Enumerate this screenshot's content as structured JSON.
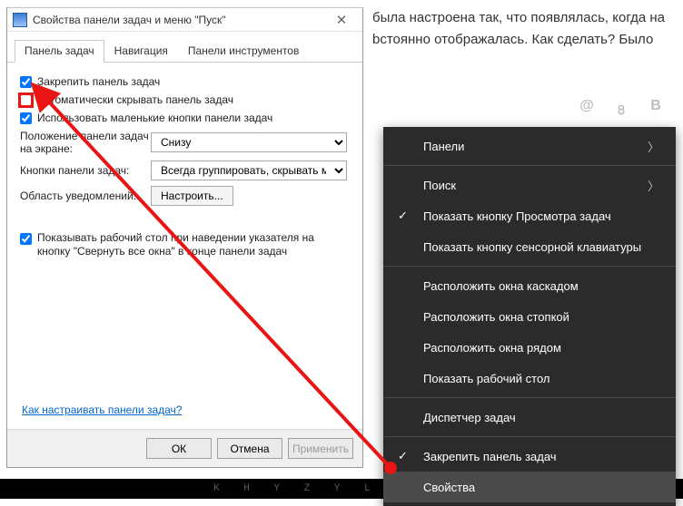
{
  "bg_text": "была настроена так, что появлялась, когда на bстоянно отображалась. Как сделать? Было",
  "icons": {
    "at": "@",
    "ok": "৪",
    "vk": "В"
  },
  "dialog": {
    "title": "Свойства панели задач и меню \"Пуск\"",
    "tabs": [
      "Панель задач",
      "Навигация",
      "Панели инструментов"
    ],
    "checkbox": {
      "lock": "Закрепить панель задач",
      "autohide": "Автоматически скрывать панель задач",
      "small": "Использовать маленькие кнопки панели задач"
    },
    "position": {
      "label": "Положение панели задач на экране:",
      "value": "Снизу"
    },
    "buttons_grouping": {
      "label": "Кнопки панели задач:",
      "value": "Всегда группировать, скрывать метки"
    },
    "notif": {
      "label": "Область уведомлений:",
      "button": "Настроить..."
    },
    "peek": "Показывать рабочий стол при наведении указателя на кнопку \"Свернуть все окна\" в конце панели задач",
    "help": "Как настраивать панели задач?",
    "ok": "ОК",
    "cancel": "Отмена",
    "apply": "Применить"
  },
  "menu": {
    "panels": "Панели",
    "search": "Поиск",
    "task_view": "Показать кнопку Просмотра задач",
    "touch_kb": "Показать кнопку сенсорной клавиатуры",
    "cascade": "Расположить окна каскадом",
    "stacked": "Расположить окна стопкой",
    "side": "Расположить окна рядом",
    "desktop": "Показать рабочий стол",
    "taskmgr": "Диспетчер задач",
    "lock": "Закрепить панель задач",
    "props": "Свойства"
  },
  "bottom_strip": "K H Y Z Y L  S"
}
